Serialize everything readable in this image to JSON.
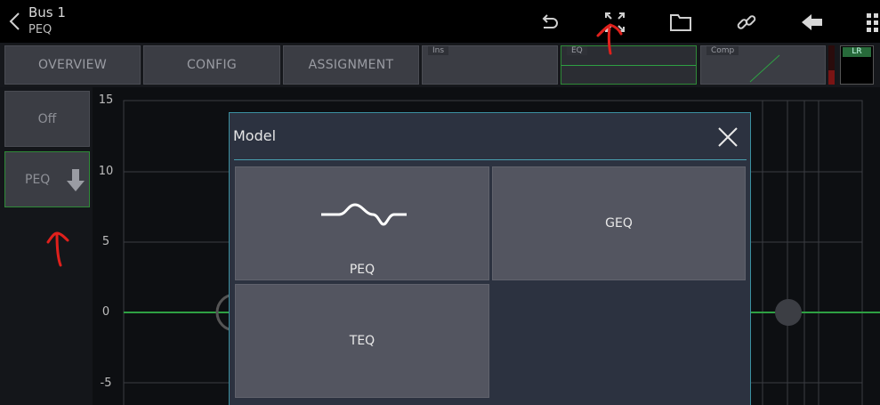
{
  "header": {
    "title": "Bus 1",
    "subtitle": "PEQ",
    "icons": [
      "back-chevron-icon",
      "undo-icon",
      "fullscreen-icon",
      "folder-icon",
      "link-icon",
      "arrow-left-icon",
      "grid-menu-icon"
    ]
  },
  "tabs": [
    {
      "label": "OVERVIEW"
    },
    {
      "label": "CONFIG"
    },
    {
      "label": "ASSIGNMENT"
    }
  ],
  "mini_panels": [
    {
      "label": "Ins"
    },
    {
      "label": "EQ"
    },
    {
      "label": "Comp"
    }
  ],
  "lr_label": "LR",
  "sidebar": {
    "off_label": "Off",
    "peq_label": "PEQ"
  },
  "graph": {
    "y_ticks": [
      "15",
      "10",
      "5",
      "0",
      "-5"
    ],
    "line_color": "#2ea043"
  },
  "modal": {
    "title": "Model",
    "options": [
      {
        "label": "PEQ",
        "icon": "peq-curve-icon"
      },
      {
        "label": "GEQ"
      },
      {
        "label": "TEQ"
      }
    ]
  },
  "colors": {
    "accent_green": "#2f8a38",
    "modal_border": "#3b8fa0",
    "annotation_red": "#e0201c"
  }
}
